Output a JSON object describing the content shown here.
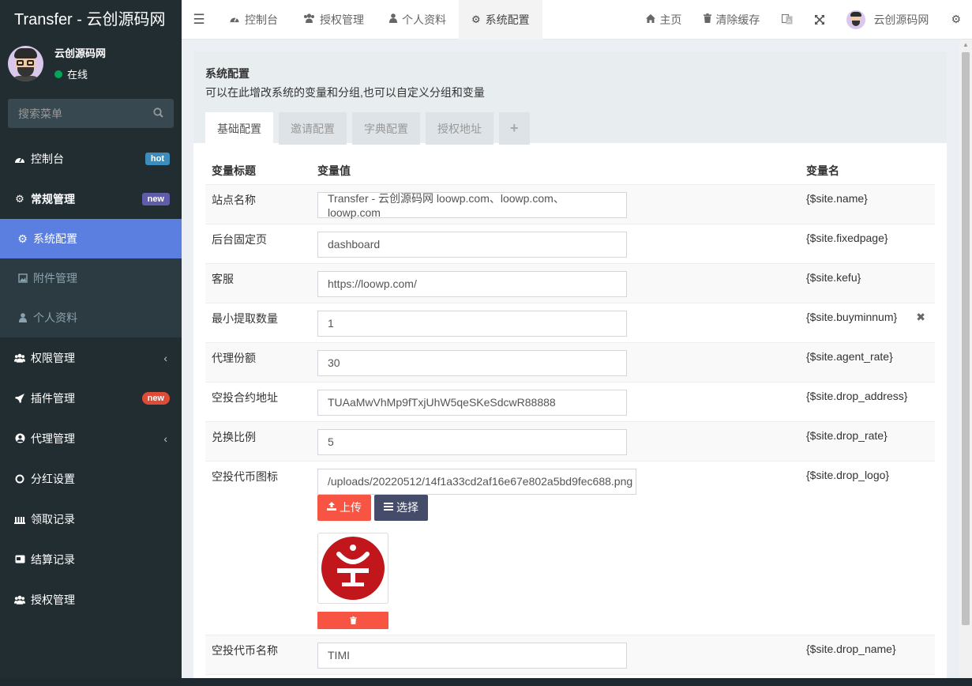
{
  "brand": "Transfer - 云创源码网",
  "user": {
    "name": "云创源码网",
    "status": "在线"
  },
  "sidebar": {
    "search_placeholder": "搜索菜单",
    "items": [
      {
        "label": "控制台",
        "icon": "dashboard-icon",
        "badge": "hot"
      },
      {
        "label": "常规管理",
        "icon": "cogs-icon",
        "badge": "new"
      },
      {
        "label": "系统配置",
        "icon": "cog-icon"
      },
      {
        "label": "附件管理",
        "icon": "image-icon"
      },
      {
        "label": "个人资料",
        "icon": "user-icon"
      },
      {
        "label": "权限管理",
        "icon": "group-icon"
      },
      {
        "label": "插件管理",
        "icon": "rocket-icon",
        "badge": "new"
      },
      {
        "label": "代理管理",
        "icon": "user-circle-icon"
      },
      {
        "label": "分红设置",
        "icon": "circle-icon"
      },
      {
        "label": "领取记录",
        "icon": "bank-icon"
      },
      {
        "label": "结算记录",
        "icon": "credit-card-icon"
      },
      {
        "label": "授权管理",
        "icon": "group-icon"
      }
    ]
  },
  "header": {
    "tabs": [
      {
        "label": "控制台",
        "icon": "dashboard-icon"
      },
      {
        "label": "授权管理",
        "icon": "group-icon"
      },
      {
        "label": "个人资料",
        "icon": "user-icon"
      },
      {
        "label": "系统配置",
        "icon": "cog-icon"
      }
    ],
    "home": "主页",
    "clear_cache": "清除缓存",
    "username": "云创源码网"
  },
  "panel": {
    "title": "系统配置",
    "desc": "可以在此增改系统的变量和分组,也可以自定义分组和变量",
    "tabs": [
      "基础配置",
      "邀请配置",
      "字典配置",
      "授权地址",
      "+"
    ]
  },
  "table": {
    "headers": [
      "变量标题",
      "变量值",
      "变量名"
    ],
    "rows": [
      {
        "title": "站点名称",
        "value": "Transfer - 云创源码网 loowp.com、loowp.com、loowp.com",
        "name": "{$site.name}"
      },
      {
        "title": "后台固定页",
        "value": "dashboard",
        "name": "{$site.fixedpage}"
      },
      {
        "title": "客服",
        "value": "https://loowp.com/",
        "name": "{$site.kefu}"
      },
      {
        "title": "最小提取数量",
        "value": "1",
        "name": "{$site.buyminnum}"
      },
      {
        "title": "代理份额",
        "value": "30",
        "name": "{$site.agent_rate}"
      },
      {
        "title": "空投合约地址",
        "value": "TUAaMwVhMp9fTxjUhW5qeSKeSdcwR88888",
        "name": "{$site.drop_address}"
      },
      {
        "title": "兑换比例",
        "value": "5",
        "name": "{$site.drop_rate}"
      },
      {
        "title": "空投代币图标",
        "value": "/uploads/20220512/14f1a33cd2af16e67e802a5bd9fec688.png",
        "name": "{$site.drop_logo}"
      },
      {
        "title": "空投代币名称",
        "value": "TIMI",
        "name": "{$site.drop_name}"
      }
    ],
    "upload_label": "上传",
    "choose_label": "选择"
  },
  "colors": {
    "sidebar": "#222d32",
    "active": "#5b7fe0",
    "danger": "#f75444",
    "navy": "#444c69",
    "logo_red": "#c0161c"
  }
}
